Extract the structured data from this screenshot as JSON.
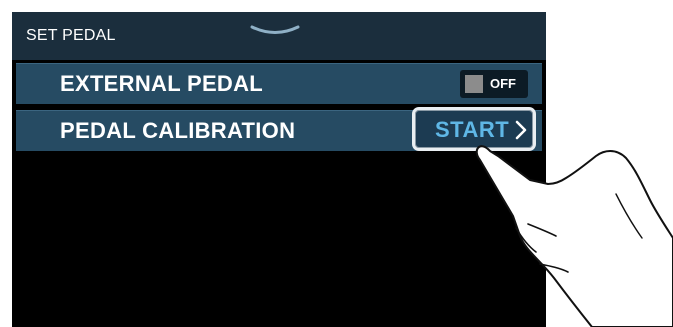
{
  "header": {
    "title": "SET PEDAL",
    "collapse_icon": "chevron-down-icon"
  },
  "settings": {
    "external_pedal": {
      "label": "EXTERNAL PEDAL",
      "toggle_state": "OFF"
    },
    "pedal_calibration": {
      "label": "PEDAL CALIBRATION",
      "button_label": "START",
      "button_icon": "chevron-right-icon"
    }
  },
  "overlay": {
    "pointer_icon": "hand-pointer-icon"
  },
  "colors": {
    "screen_background": "#000000",
    "header_background": "#1b2e3d",
    "row_background": "#264b63",
    "start_text": "#5fb7e6",
    "toggle_knob": "#8c8c8c"
  }
}
